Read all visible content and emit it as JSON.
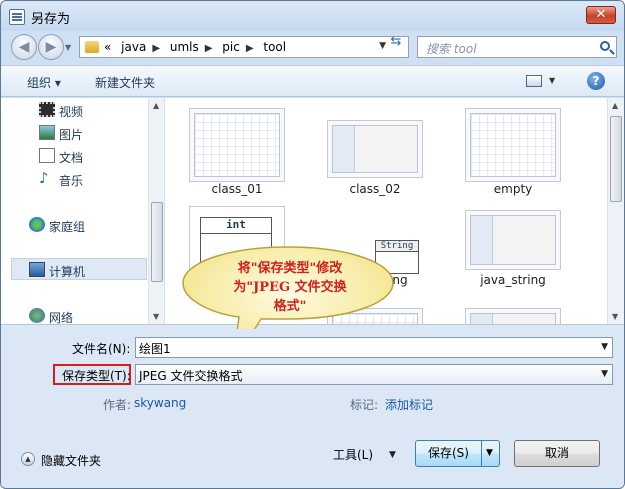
{
  "window": {
    "title": "另存为",
    "close_label": "✕"
  },
  "nav": {
    "back_glyph": "◀",
    "forward_glyph": "▶",
    "breadcrumbs": [
      "«",
      "java",
      "umls",
      "pic",
      "tool"
    ],
    "search_placeholder": "搜索 tool"
  },
  "toolbar": {
    "organize": "组织 ▾",
    "new_folder": "新建文件夹",
    "help": "?"
  },
  "sidebar": {
    "items": [
      {
        "label": "视频",
        "icon": "video-icon"
      },
      {
        "label": "图片",
        "icon": "picture-icon"
      },
      {
        "label": "文档",
        "icon": "document-icon"
      },
      {
        "label": "音乐",
        "icon": "music-icon"
      },
      {
        "label": "家庭组",
        "icon": "homegroup-icon"
      },
      {
        "label": "计算机",
        "icon": "computer-icon"
      },
      {
        "label": "网络",
        "icon": "network-icon"
      }
    ]
  },
  "files": [
    {
      "name": "class_01"
    },
    {
      "name": "class_02"
    },
    {
      "name": "empty"
    },
    {
      "name": "",
      "uml_header": "int"
    },
    {
      "name": "ng",
      "uml_header": "String"
    },
    {
      "name": "java_string"
    }
  ],
  "callout": {
    "line1": "将\"保存类型\"修改",
    "line2": "为\"JPEG 文件交换",
    "line3": "格式\""
  },
  "form": {
    "filename_label": "文件名(N):",
    "filename_value": "绘图1",
    "type_label": "保存类型(T):",
    "type_value": "JPEG 文件交换格式",
    "author_label": "作者:",
    "author_value": "skywang",
    "tags_label": "标记:",
    "tags_value": "添加标记"
  },
  "footer": {
    "hide_folders": "隐藏文件夹",
    "tools": "工具(L)",
    "save": "保存(S)",
    "cancel": "取消"
  }
}
